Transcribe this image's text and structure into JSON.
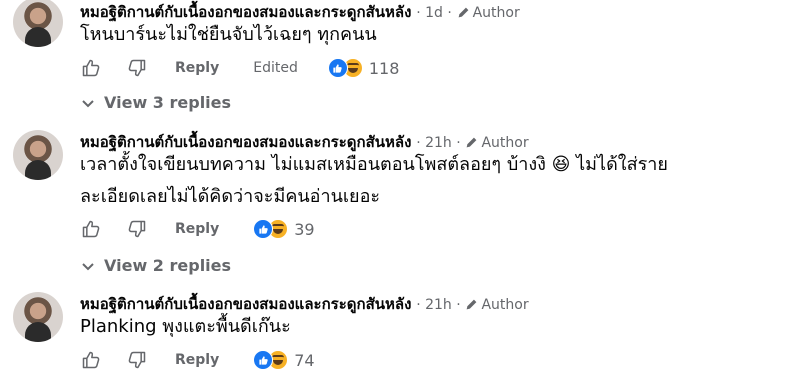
{
  "comments": [
    {
      "author": "หมอฐิติกานต์กับเนื้องอกของสมองและกระดูกสันหลัง",
      "time": "· 1d ·",
      "badge": "Author",
      "text": "โหนบาร์นะไม่ใช่ยืนจับไว้เฉยๆ ทุกคนน",
      "reply_label": "Reply",
      "edited_label": "Edited",
      "reaction_count": "118",
      "view_replies": "View 3 replies"
    },
    {
      "author": "หมอฐิติกานต์กับเนื้องอกของสมองและกระดูกสันหลัง",
      "time": "· 21h ·",
      "badge": "Author",
      "text_line1": "เวลาตั้งใจเขียนบทความ ไม่แมสเหมือนตอนโพสต์ลอยๆ บ้างงิ 😆 ไม่ได้ใส่ราย",
      "text_line2": "ละเอียดเลยไม่ได้คิดว่าจะมีคนอ่านเยอะ",
      "reply_label": "Reply",
      "reaction_count": "39",
      "view_replies": "View 2 replies"
    },
    {
      "author": "หมอฐิติกานต์กับเนื้องอกของสมองและกระดูกสันหลัง",
      "time": "· 21h ·",
      "badge": "Author",
      "text": "Planking พุงแตะพื้นดีเก๊นะ",
      "reply_label": "Reply",
      "reaction_count": "74"
    }
  ],
  "colors": {
    "accent_like": "#1877f2",
    "muted": "#65676b",
    "text": "#050505"
  }
}
